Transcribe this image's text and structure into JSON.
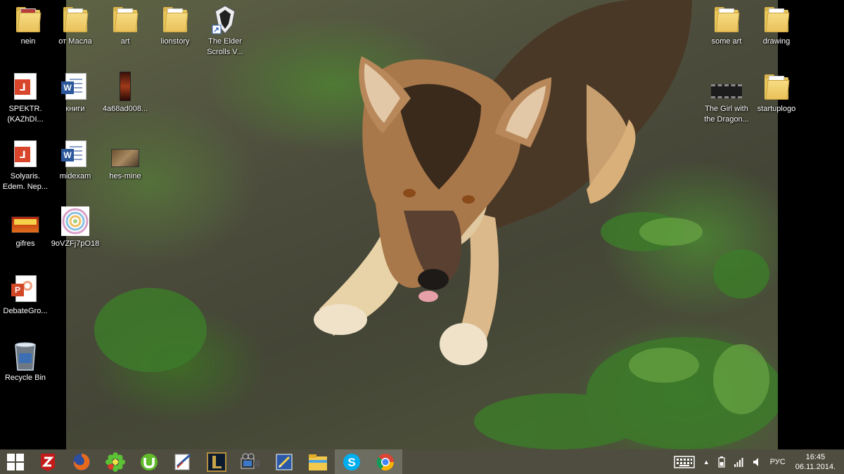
{
  "desktop": {
    "icons": [
      {
        "label": "nein",
        "icon": "folder-icon"
      },
      {
        "label": "от Масла",
        "icon": "folder-icon"
      },
      {
        "label": "art",
        "icon": "folder-icon"
      },
      {
        "label": "lionstory",
        "icon": "folder-icon"
      },
      {
        "label": "The Elder Scrolls V...",
        "icon": "skyrim-shortcut-icon"
      },
      {
        "label": "SPEKTR. (KAZhDI...",
        "icon": "pdf-icon"
      },
      {
        "label": "книги",
        "icon": "word-document-icon"
      },
      {
        "label": "4a68ad008...",
        "icon": "image-file-icon"
      },
      {
        "label": "Solyaris. Edem. Nep...",
        "icon": "pdf-icon"
      },
      {
        "label": "midexam",
        "icon": "word-document-icon"
      },
      {
        "label": "hes-mine",
        "icon": "image-file-icon"
      },
      {
        "label": "gifres",
        "icon": "gif-image-icon"
      },
      {
        "label": "9oVZFj7pO18",
        "icon": "image-file-icon"
      },
      {
        "label": "DebateGro...",
        "icon": "powerpoint-document-icon"
      },
      {
        "label": "Recycle Bin",
        "icon": "recycle-bin-icon"
      },
      {
        "label": "some art",
        "icon": "folder-icon"
      },
      {
        "label": "drawing",
        "icon": "folder-icon"
      },
      {
        "label": "The Girl with the Dragon...",
        "icon": "video-file-icon"
      },
      {
        "label": "startuplogo",
        "icon": "folder-icon"
      }
    ],
    "wallpaper": "german-shepherd-dog-on-grass"
  },
  "taskbar": {
    "buttons": [
      {
        "name": "start-button",
        "icon": "windows-logo-icon"
      },
      {
        "name": "taskbar-zotero",
        "icon": "zotero-icon"
      },
      {
        "name": "taskbar-firefox",
        "icon": "firefox-icon"
      },
      {
        "name": "taskbar-icq",
        "icon": "icq-flower-icon"
      },
      {
        "name": "taskbar-utorrent",
        "icon": "utorrent-icon"
      },
      {
        "name": "taskbar-app",
        "icon": "app-icon"
      },
      {
        "name": "taskbar-league-of-legends",
        "icon": "league-of-legends-icon"
      },
      {
        "name": "taskbar-video-editor",
        "icon": "film-camera-icon"
      },
      {
        "name": "taskbar-notepad",
        "icon": "pen-note-icon"
      },
      {
        "name": "taskbar-file-explorer",
        "icon": "file-explorer-icon"
      },
      {
        "name": "taskbar-skype",
        "icon": "skype-icon"
      },
      {
        "name": "taskbar-chrome",
        "icon": "chrome-icon"
      }
    ],
    "tray": {
      "language": "РУС",
      "time": "16:45",
      "date": "06.11.2014."
    }
  },
  "colors": {
    "taskbar": "#525042",
    "folder": "#e8c75a",
    "word": "#2b579a",
    "powerpoint": "#d24726",
    "pdf": "#d9452a"
  }
}
